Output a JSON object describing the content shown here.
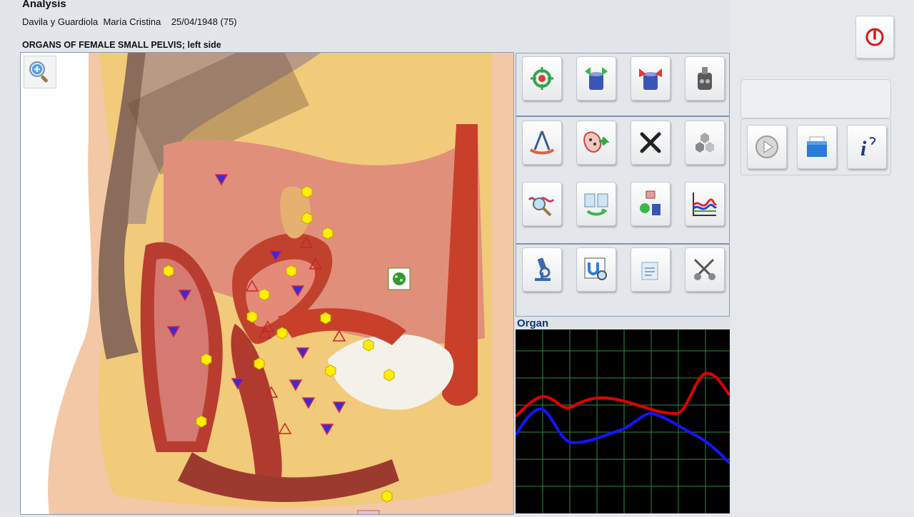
{
  "window": {
    "title": "Analysis"
  },
  "patient": {
    "name": "Davila y Guardiola  María Cristina",
    "dob": "25/04/1948",
    "age": "(75)"
  },
  "section": {
    "title": "ORGANS OF FEMALE SMALL PELVIS; left side"
  },
  "image": {
    "zoom_icon": "magnifier-plus-icon",
    "figure": "female pelvis sagittal section illustration"
  },
  "toolbar": {
    "rows": [
      [
        "target-icon",
        "cylinder-arrows-up-icon",
        "cylinder-arrows-down-icon",
        "device-icon"
      ],
      [
        "compass-icon",
        "cells-arrow-icon",
        "close-x-icon",
        "hexagons-icon"
      ],
      [
        "wave-magnifier-icon",
        "transfer-pages-icon",
        "recycle-bins-icon",
        "graph-grid-icon"
      ],
      [
        "microscope-icon",
        "magnet-search-icon",
        "clipboard-icon",
        "scissors-pills-icon"
      ]
    ]
  },
  "organ_panel": {
    "title": "Organ"
  },
  "controls": {
    "power_icon": "power-icon",
    "play_icon": "play-icon",
    "archive_icon": "archive-icon",
    "info_icon": "info-icon"
  },
  "colors": {
    "curve_red": "#e00000",
    "curve_blue": "#1414ff",
    "grid": "#2e8b3a",
    "marker_yellow": "#ffee00",
    "marker_triangle_blue": "#3a2bd6",
    "marker_triangle_red": "#c8242a"
  }
}
